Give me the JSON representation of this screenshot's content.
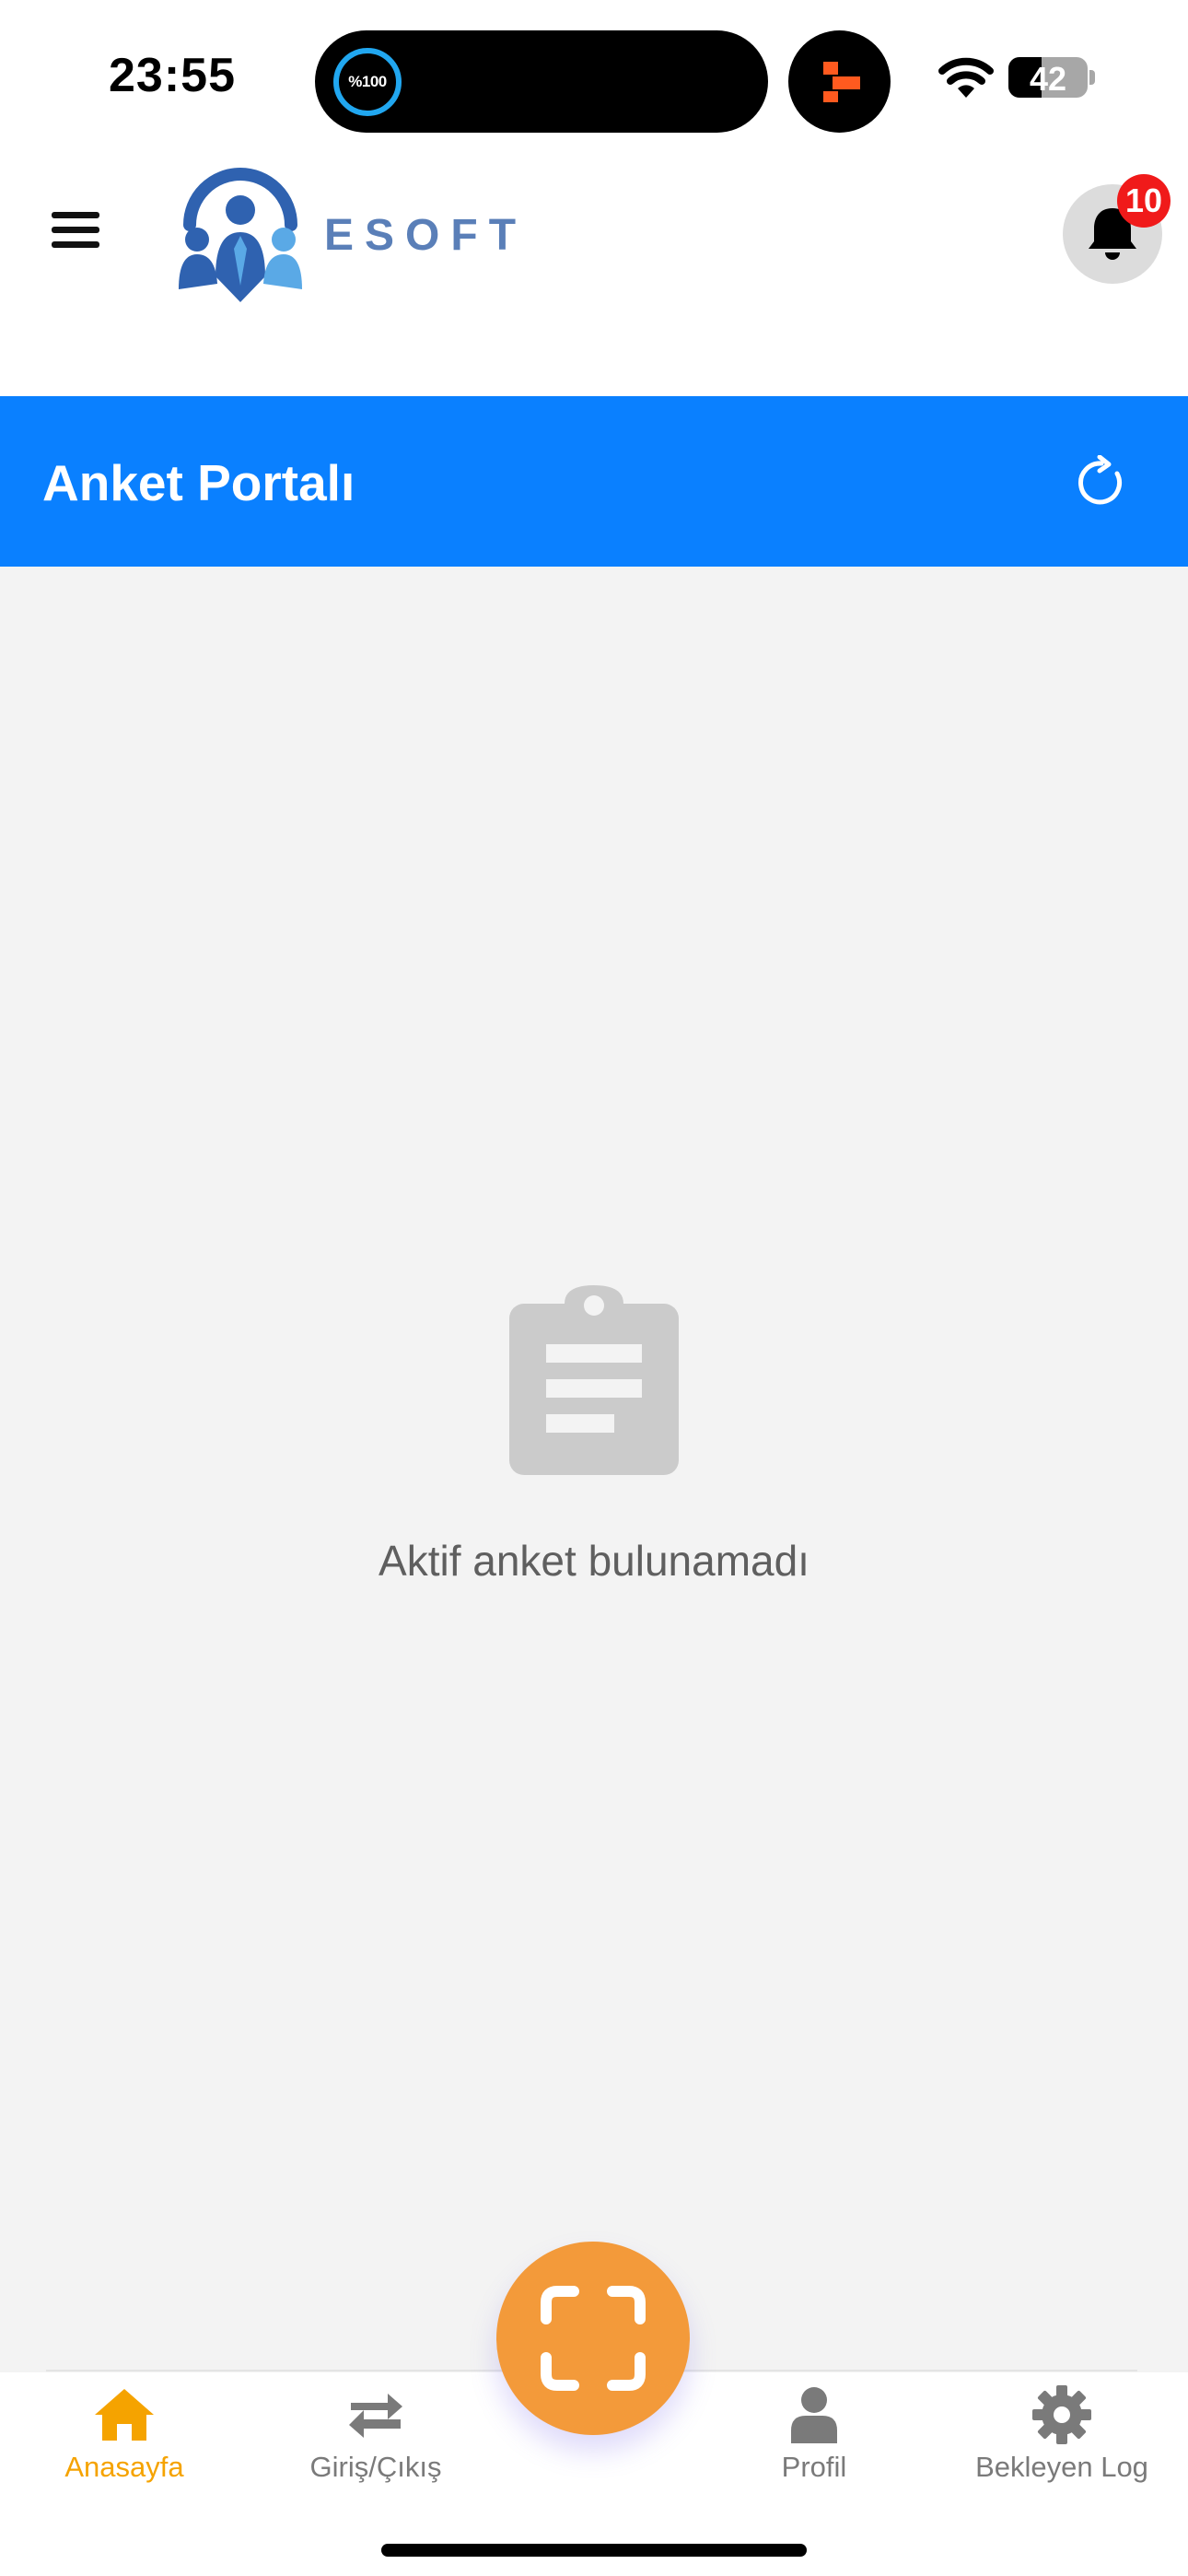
{
  "status_bar": {
    "time": "23:55",
    "activity_progress": "%100",
    "battery_level": "42",
    "battery_fraction": 0.42
  },
  "header": {
    "logo_text": "ESOFT",
    "notification_count": "10",
    "icons": {
      "menu": "hamburger-menu-icon",
      "notifications": "bell-icon"
    }
  },
  "title_bar": {
    "title": "Anket Portalı",
    "background_color": "#0a80ff",
    "refresh_icon": "refresh-icon"
  },
  "content": {
    "empty_state_icon": "clipboard-icon",
    "empty_message": "Aktif anket bulunamadı"
  },
  "bottom_nav": {
    "active_color": "#f5a300",
    "scan_button_color": "#f39a3a",
    "items": [
      {
        "label": "Anasayfa",
        "icon": "home-icon",
        "active": true
      },
      {
        "label": "Giriş/Çıkış",
        "icon": "swap-arrows-icon",
        "active": false
      },
      {
        "label": "Profil",
        "icon": "user-icon",
        "active": false
      },
      {
        "label": "Bekleyen Log",
        "icon": "gear-icon",
        "active": false
      }
    ],
    "scan_icon": "scan-frame-icon"
  }
}
